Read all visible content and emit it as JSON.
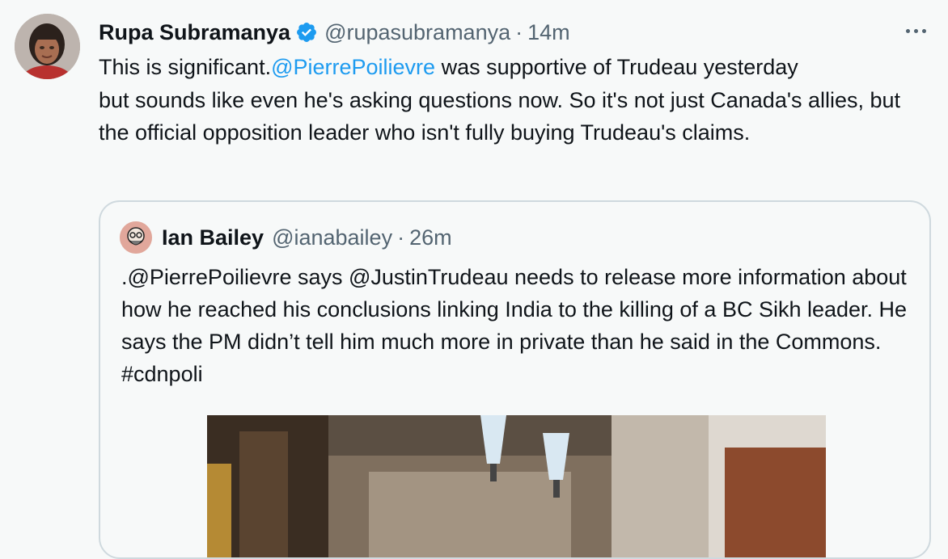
{
  "tweet": {
    "author_name": "Rupa Subramanya",
    "handle": "@rupasubramanya",
    "separator": "·",
    "time": "14m",
    "text_prefix": "This is significant.",
    "mention": "@PierrePoilievre",
    "text_line1_rest": " was supportive of Trudeau yesterday",
    "text_rest": "but sounds like even he's asking questions now. So it's not just Canada's allies, but the official opposition leader who isn't fully buying Trudeau's claims."
  },
  "quoted": {
    "author_name": "Ian Bailey",
    "handle": "@ianabailey",
    "separator": "·",
    "time": "26m",
    "text": ".@PierrePoilievre says @JustinTrudeau needs to release more information about how he reached his conclusions linking India to the killing of a BC Sikh leader. He says the PM didn’t tell him much more in private than he said in the Commons. #cdnpoli"
  },
  "icons": {
    "verified": "verified-badge-icon",
    "more": "more-options-icon"
  },
  "colors": {
    "link": "#1d9bf0",
    "secondary_text": "#536471",
    "border": "#cfd9de",
    "background": "#f7f9f9"
  }
}
